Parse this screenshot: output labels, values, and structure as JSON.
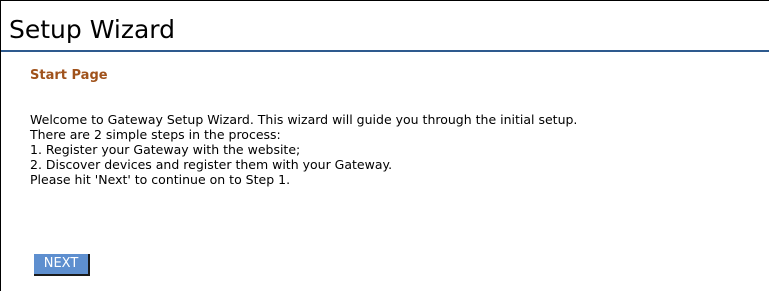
{
  "header": {
    "title": "Setup Wizard"
  },
  "step": {
    "heading": "Start Page"
  },
  "intro": {
    "lines": [
      "Welcome to Gateway Setup Wizard. This wizard will guide you through the initial setup.",
      "There are 2 simple steps in the process:",
      "1. Register your Gateway with the website;",
      "2. Discover devices and register them with your Gateway.",
      "Please hit 'Next' to continue on to Step 1."
    ]
  },
  "actions": {
    "next_label": "NEXT"
  },
  "colors": {
    "title_rule": "#2e5a8e",
    "step_heading": "#a0521b",
    "button_bg": "#5e8fcf"
  }
}
